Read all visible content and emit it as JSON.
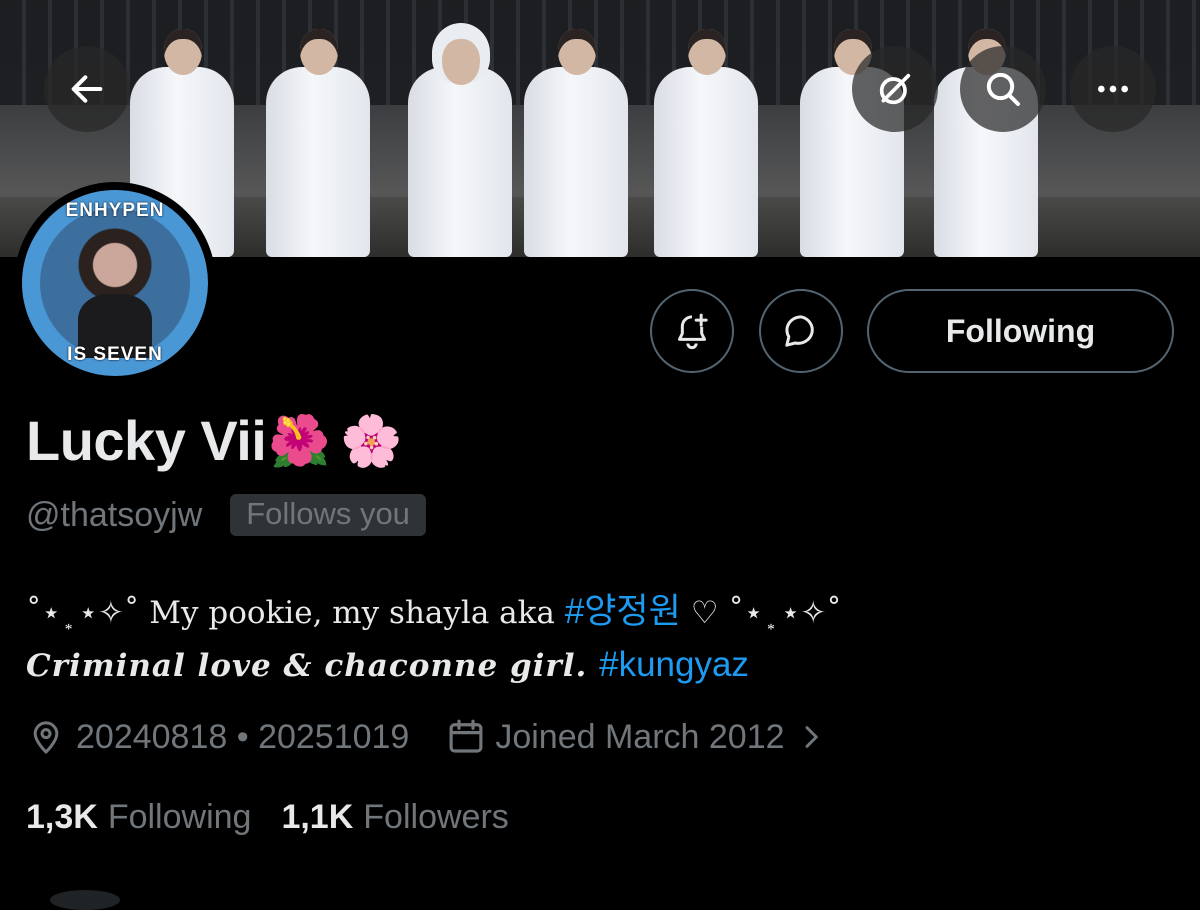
{
  "banner": {
    "back_icon": "arrow-left-icon",
    "grok_icon": "grok-icon",
    "search_icon": "search-icon",
    "more_icon": "more-horizontal-icon"
  },
  "avatar": {
    "top_text": "ENHYPEN",
    "bottom_text": "IS SEVEN"
  },
  "actions": {
    "notify_icon": "bell-plus-icon",
    "message_icon": "message-bubble-icon",
    "following_label": "Following"
  },
  "profile": {
    "name": "Lucky Vii",
    "name_emoji_1": "🌺",
    "name_emoji_2": "🌸",
    "handle": "@thatsoyjw",
    "follows_you": "Follows you",
    "bio_line1_text": "˚⋆ ͙ ⋆✧˚ My pookie, my shayla aka ",
    "bio_line1_tag": "#양정원",
    "bio_line1_tail": " ♡ ˚⋆ ͙ ⋆✧˚",
    "bio_line2_text": "Criminal love & chaconne girl. ",
    "bio_line2_tag": "#kungyaz",
    "location": "20240818 • 20251019",
    "joined": "Joined March 2012"
  },
  "stats": {
    "following_count": "1,3K",
    "following_label": "Following",
    "followers_count": "1,1K",
    "followers_label": "Followers"
  },
  "colors": {
    "accent": "#1d9bf0",
    "muted": "#71767b",
    "border": "#536471",
    "background": "#000000"
  }
}
